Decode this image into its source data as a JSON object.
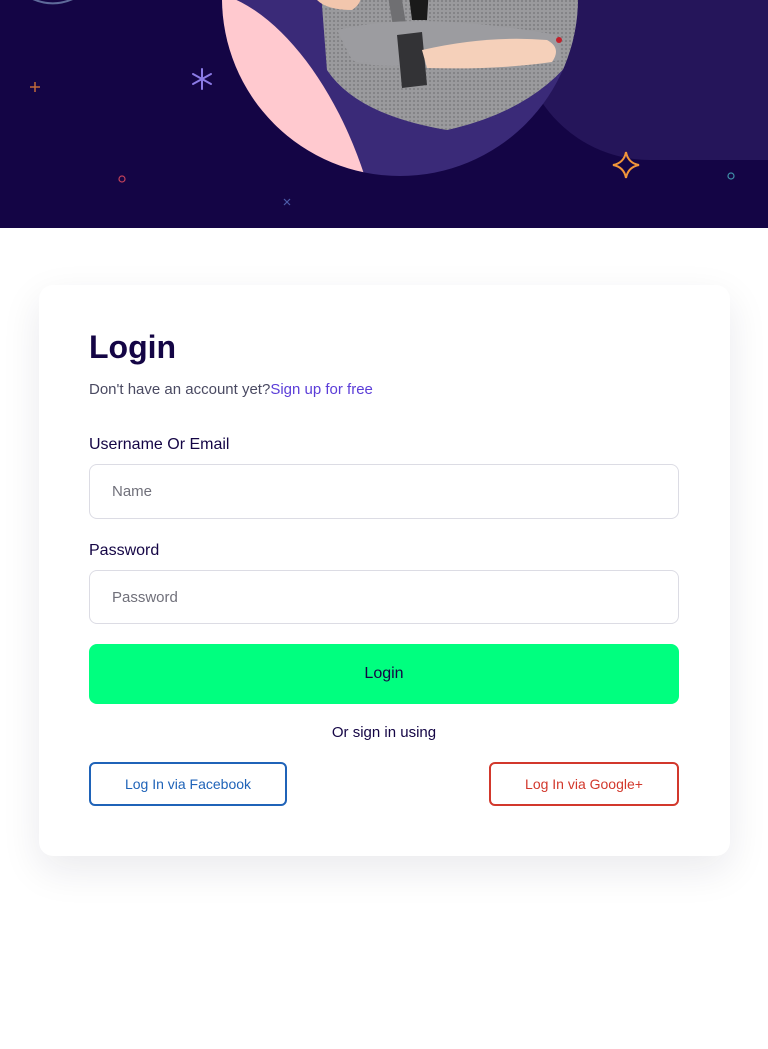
{
  "hero": {
    "image_alt": "person-in-grey-blazer-arms-crossed"
  },
  "login": {
    "title": "Login",
    "no_account_text": "Don't have an account yet?",
    "signup_link": "Sign up for free",
    "username_label": "Username Or Email",
    "username_placeholder": "Name",
    "username_value": "",
    "password_label": "Password",
    "password_placeholder": "Password",
    "password_value": "",
    "login_button": "Login",
    "or_text": "Or sign in using",
    "facebook_button": "Log In via Facebook",
    "google_button": "Log In via Google+"
  },
  "colors": {
    "hero_background": "#140545",
    "accent_green": "#00ff7f",
    "link_purple": "#5b3dd8",
    "facebook_blue": "#1f63b8",
    "google_red": "#d2382c"
  },
  "icons": [
    "sparkle-star-icon",
    "asterisk-star-icon",
    "plus-icon",
    "small-circle-icon",
    "small-x-icon"
  ]
}
